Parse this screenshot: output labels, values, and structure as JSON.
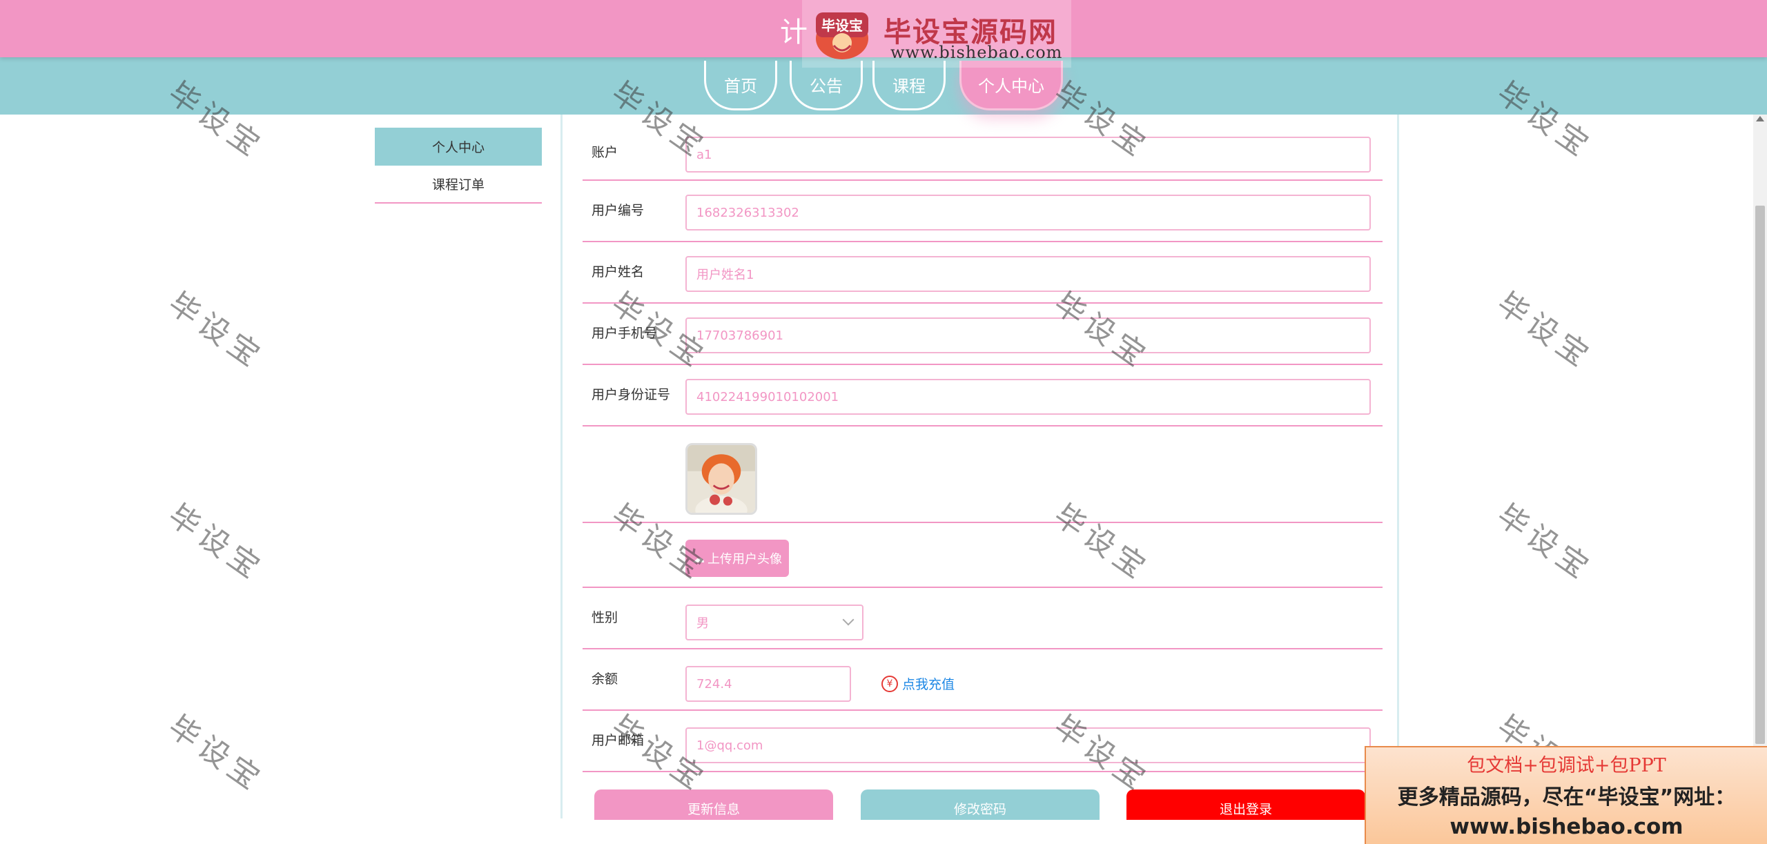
{
  "header": {
    "title": "计",
    "brand_name": "毕设宝源码网",
    "brand_badge": "毕设宝",
    "brand_url": "www.bishebao.com"
  },
  "nav": [
    {
      "label": "首页",
      "active": false
    },
    {
      "label": "公告",
      "active": false
    },
    {
      "label": "课程",
      "active": false
    },
    {
      "label": "个人中心",
      "active": true
    }
  ],
  "sidebar": [
    {
      "label": "个人中心",
      "active": true
    },
    {
      "label": "课程订单",
      "active": false
    }
  ],
  "form": {
    "account": {
      "label": "账户",
      "value": "a1"
    },
    "user_no": {
      "label": "用户编号",
      "value": "1682326313302"
    },
    "user_name": {
      "label": "用户姓名",
      "value": "用户姓名1"
    },
    "phone": {
      "label": "用户手机号",
      "value": "17703786901"
    },
    "id_card": {
      "label": "用户身份证号",
      "value": "410224199010102001"
    },
    "avatar_upload": {
      "label": "上传用户头像"
    },
    "gender": {
      "label": "性别",
      "value": "男"
    },
    "balance": {
      "label": "余额",
      "value": "724.4",
      "recharge_label": "点我充值",
      "recharge_icon": "¥"
    },
    "email": {
      "label": "用户邮箱",
      "value": "1@qq.com"
    }
  },
  "buttons": {
    "update": "更新信息",
    "change_password": "修改密码",
    "logout": "退出登录"
  },
  "watermark": "毕设宝",
  "promo": {
    "line1": "包文档+包调试+包PPT",
    "line2": "更多精品源码，尽在“毕设宝”网址：",
    "line3": "www.bishebao.com"
  },
  "colors": {
    "pink": "#f296c4",
    "teal": "#93cfd5",
    "logout_red": "#ff0000",
    "link_blue": "#1e88e5"
  }
}
